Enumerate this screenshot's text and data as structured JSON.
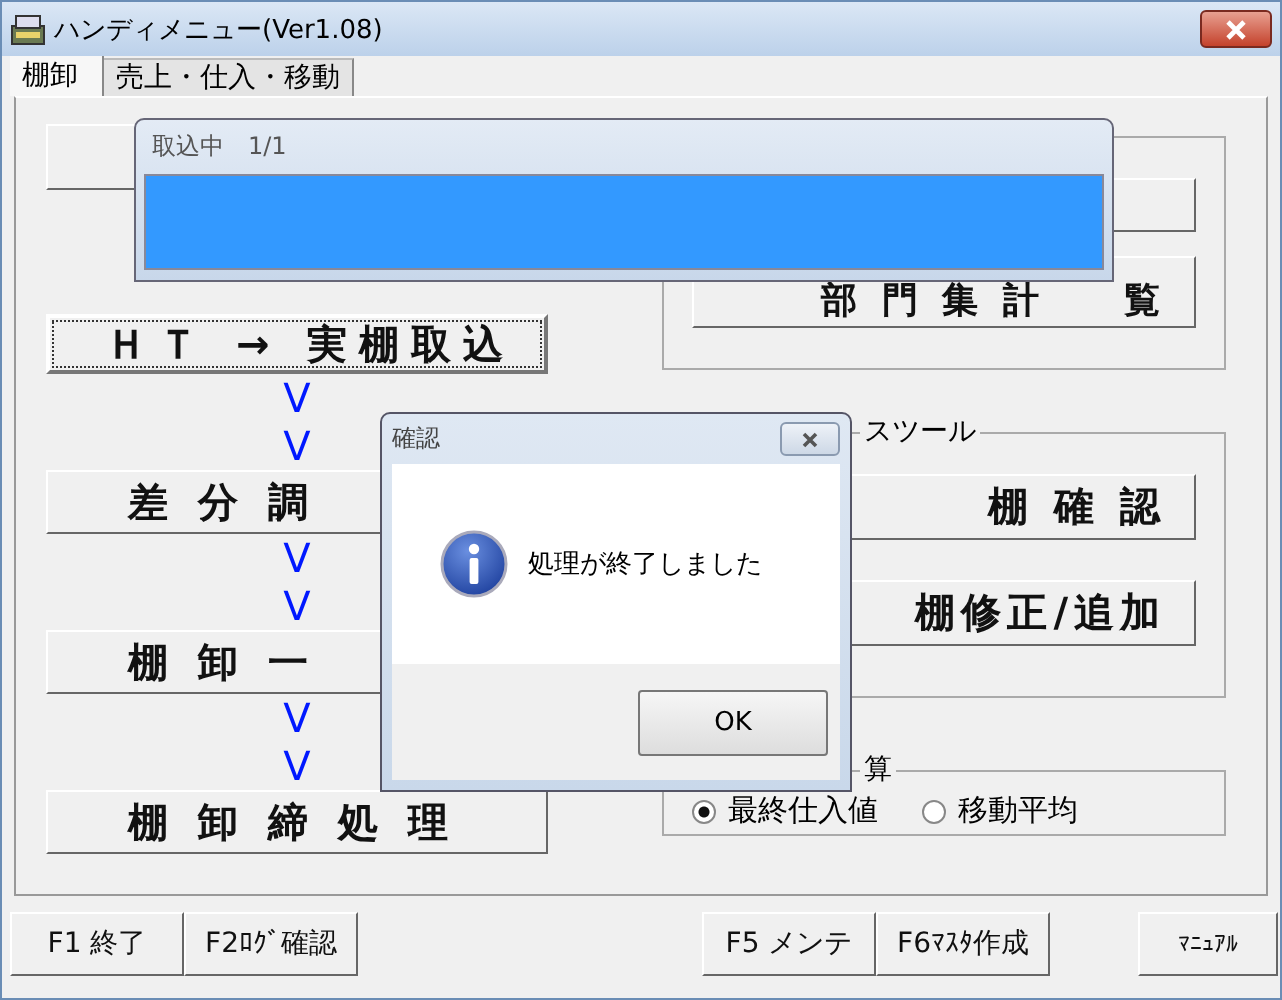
{
  "window": {
    "title": "ハンディメニュー(Ver1.08)"
  },
  "tabs": [
    {
      "label": "棚卸",
      "selected": true
    },
    {
      "label": "売上・仕入・移動",
      "selected": false
    }
  ],
  "flow": [
    {
      "kind": "blank"
    },
    {
      "kind": "button",
      "label": "ＨＴ → 実棚取込",
      "focused": true
    },
    {
      "kind": "arrow",
      "label": "V"
    },
    {
      "kind": "arrow",
      "label": "V"
    },
    {
      "kind": "button",
      "label": "差 分 調",
      "focused": false
    },
    {
      "kind": "arrow",
      "label": "V"
    },
    {
      "kind": "arrow",
      "label": "V"
    },
    {
      "kind": "button",
      "label": "棚 卸 一",
      "focused": false
    },
    {
      "kind": "arrow",
      "label": "V"
    },
    {
      "kind": "arrow",
      "label": "V"
    },
    {
      "kind": "button",
      "label": "棚 卸 締 処 理",
      "focused": false
    }
  ],
  "groups": [
    {
      "buttons": [
        {
          "kind": "blank"
        },
        {
          "kind": "button",
          "label": "部 門 集 計 　 覧"
        }
      ]
    },
    {
      "legend": "スツール",
      "buttons": [
        {
          "kind": "button",
          "label": "棚 確 認"
        },
        {
          "kind": "button",
          "label": "棚修正/追加"
        }
      ]
    },
    {
      "legend": "算",
      "radios": [
        {
          "label": "最終仕入値",
          "selected": true
        },
        {
          "label": "移動平均",
          "selected": false
        }
      ]
    }
  ],
  "function_keys": [
    [
      "F1 終了",
      "F2ﾛｸﾞ確認"
    ],
    [
      "F5 メンテ",
      "F6ﾏｽﾀ作成"
    ],
    [
      "ﾏﾆｭｱﾙ"
    ]
  ],
  "progress": {
    "title": "取込中　1/1",
    "level": 1
  },
  "dialog": {
    "title": "確認",
    "message": "処理が終了しました",
    "ok": "OK"
  }
}
